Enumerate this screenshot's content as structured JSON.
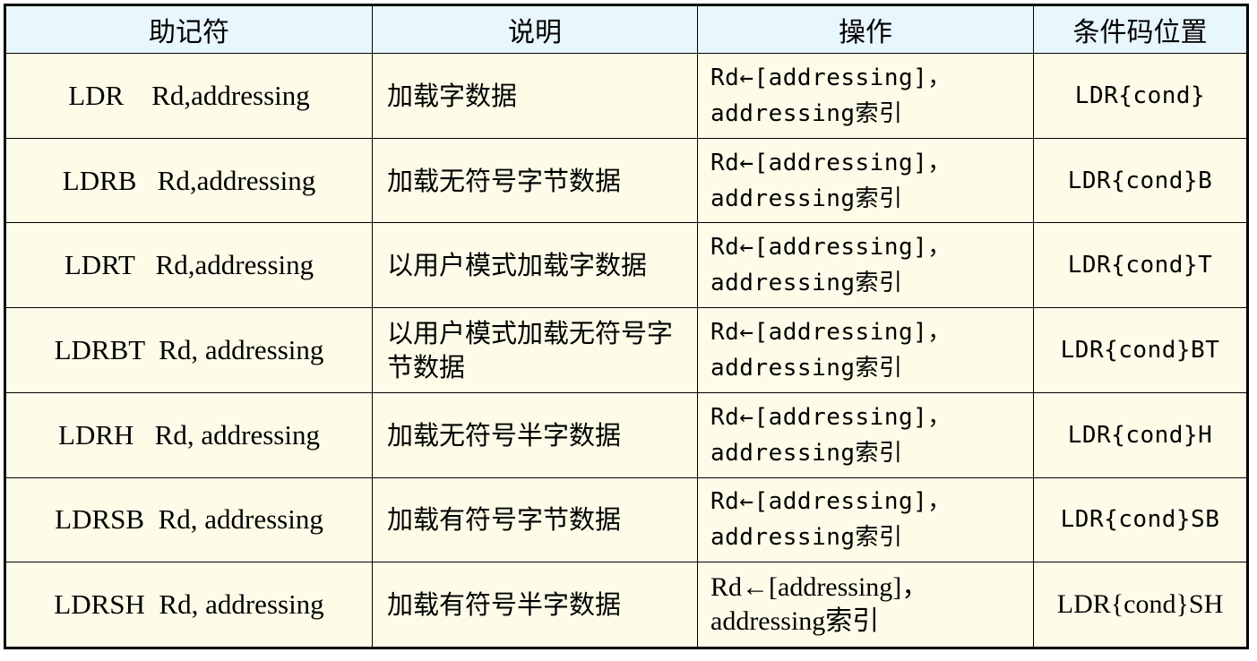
{
  "table": {
    "headers": [
      "助记符",
      "说明",
      "操作",
      "条件码位置"
    ],
    "rows": [
      {
        "mnemonic": "LDR    Rd,addressing",
        "description": "加载字数据",
        "operation_line1": "Rd←[addressing]，",
        "operation_line2": "addressing索引",
        "condition": "LDR{cond}"
      },
      {
        "mnemonic": "LDRB   Rd,addressing",
        "description": "加载无符号字节数据",
        "operation_line1": "Rd←[addressing]，",
        "operation_line2": "addressing索引",
        "condition": "LDR{cond}B"
      },
      {
        "mnemonic": "LDRT   Rd,addressing",
        "description": "以用户模式加载字数据",
        "operation_line1": "Rd←[addressing]，",
        "operation_line2": "addressing索引",
        "condition": "LDR{cond}T"
      },
      {
        "mnemonic": "LDRBT  Rd, addressing",
        "description": "以用户模式加载无符号字节数据",
        "operation_line1": "Rd←[addressing]，",
        "operation_line2": "addressing索引",
        "condition": "LDR{cond}BT"
      },
      {
        "mnemonic": "LDRH   Rd, addressing",
        "description": "加载无符号半字数据",
        "operation_line1": "Rd←[addressing]，",
        "operation_line2": "addressing索引",
        "condition": "LDR{cond}H"
      },
      {
        "mnemonic": "LDRSB  Rd, addressing",
        "description": "加载有符号字节数据",
        "operation_line1": "Rd←[addressing]，",
        "operation_line2": "addressing索引",
        "condition": "LDR{cond}SB"
      },
      {
        "mnemonic": "LDRSH  Rd, addressing",
        "description": "加载有符号半字数据",
        "operation_line1": "Rd←[addressing]，",
        "operation_line2": "addressing索引",
        "condition": "LDR{cond}SH"
      }
    ]
  },
  "colors": {
    "header_bg": "#e8f6fd",
    "cell_bg": "#fdfce8",
    "border": "#000000"
  }
}
